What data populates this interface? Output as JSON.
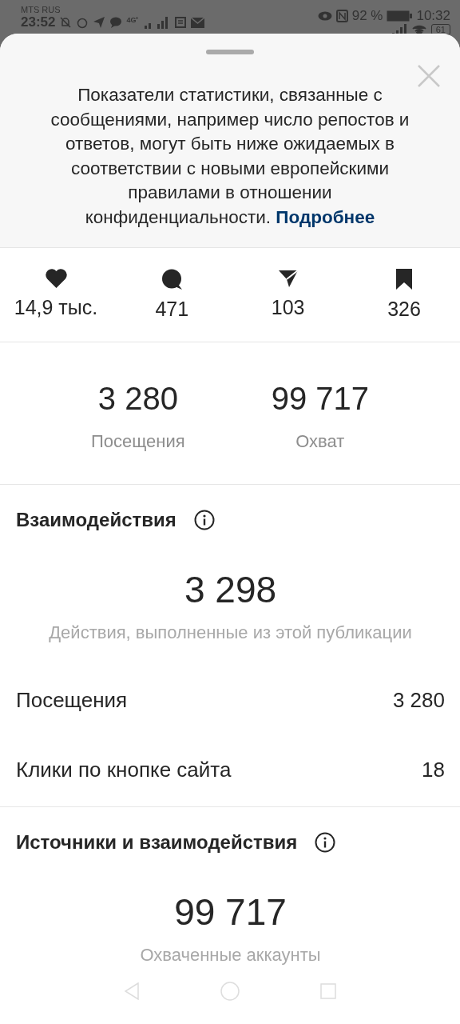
{
  "status_bar": {
    "carrier": "MTS RUS",
    "time_left": "23:52",
    "network": "4G⁺",
    "battery_percent": "92 %",
    "time_right": "10:32",
    "battery_level": "61"
  },
  "notice": {
    "text": "Показатели статистики, связанные с сообщениями, например число репостов и ответов, могут быть ниже ожидаемых в соответствии с новыми европейскими правилами в отношении конфиденциальности.",
    "link": "Подробнее"
  },
  "counters": [
    {
      "kind": "likes",
      "value": "14,9 тыс."
    },
    {
      "kind": "comments",
      "value": "471"
    },
    {
      "kind": "shares",
      "value": "103"
    },
    {
      "kind": "saves",
      "value": "326"
    }
  ],
  "overview": [
    {
      "value": "3 280",
      "label": "Посещения"
    },
    {
      "value": "99 717",
      "label": "Охват"
    }
  ],
  "sections": [
    {
      "title": "Взаимодействия",
      "total": "3 298",
      "caption": "Действия, выполненные из этой публикации",
      "rows": [
        {
          "label": "Посещения",
          "value": "3 280"
        },
        {
          "label": "Клики по кнопке сайта",
          "value": "18"
        }
      ]
    },
    {
      "title": "Источники и взаимодействия",
      "total": "99 717",
      "caption": "Охваченные аккаунты"
    }
  ]
}
